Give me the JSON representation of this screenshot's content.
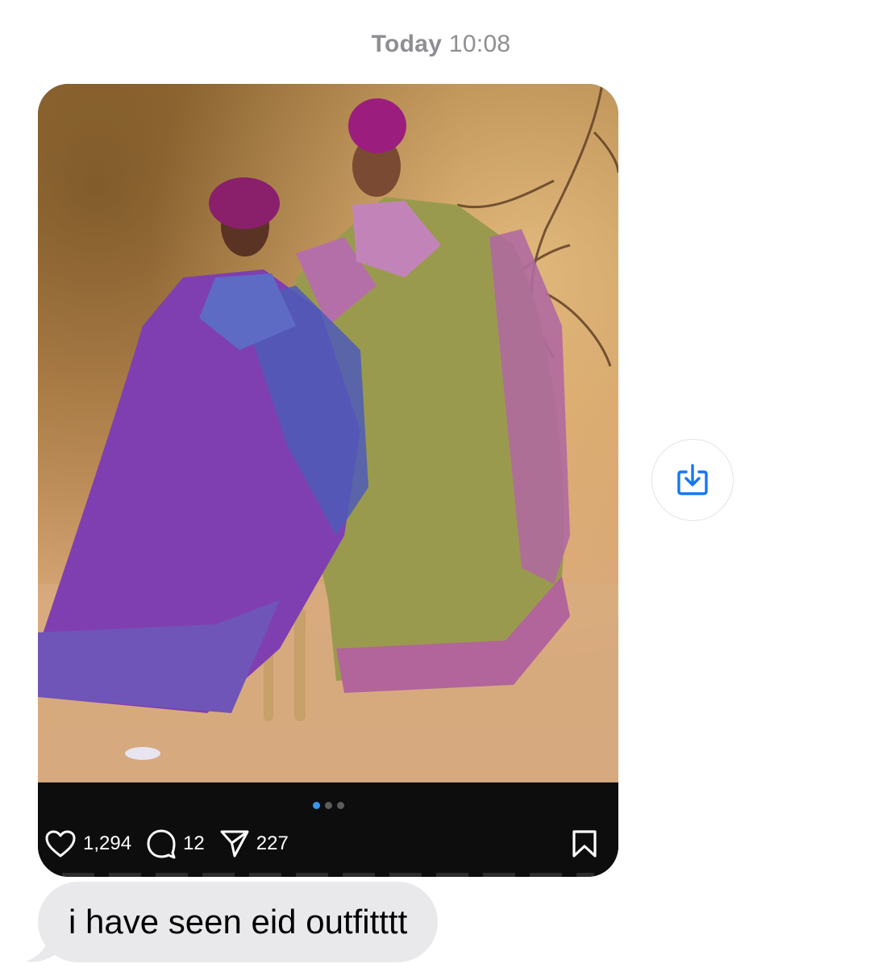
{
  "header": {
    "day": "Today",
    "time": "10:08"
  },
  "shared_post": {
    "image_alt": "Two women in purple and green embellished kaftan gowns with matching head wraps",
    "carousel": {
      "count": 3,
      "active_index": 0
    },
    "likes": "1,294",
    "comments": "12",
    "shares": "227",
    "icons": {
      "like": "heart-icon",
      "comment": "comment-bubble-icon",
      "share": "paper-plane-icon",
      "save": "bookmark-icon"
    }
  },
  "side_action": {
    "icon": "download-arrow-icon",
    "color": "#1877f2"
  },
  "message": {
    "text": "i have seen eid outfitttt"
  },
  "colors": {
    "bubble": "#e9e9eb",
    "timestamp": "#8e8e93",
    "accent": "#3797f0"
  }
}
